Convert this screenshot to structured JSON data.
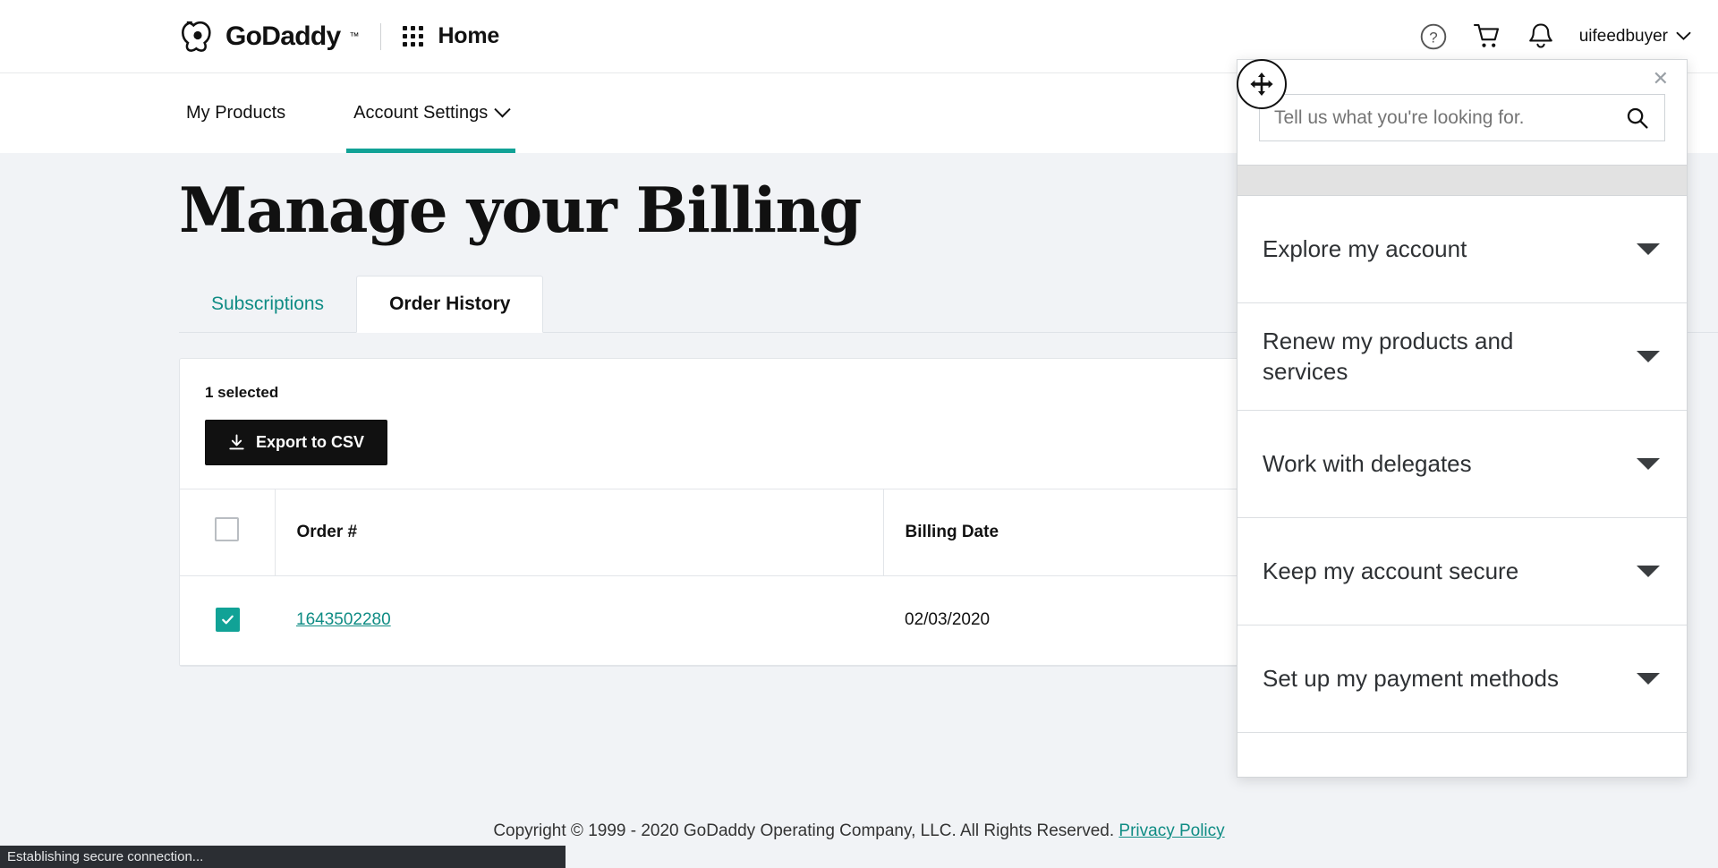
{
  "header": {
    "brand": "GoDaddy",
    "brand_tm": "™",
    "app_label": "Home",
    "help_icon": "question-circle-icon",
    "cart_icon": "shopping-cart-icon",
    "bell_icon": "notification-bell-icon",
    "username": "uifeedbuyer"
  },
  "nav": {
    "items": [
      {
        "label": "My Products",
        "active": false,
        "has_caret": false
      },
      {
        "label": "Account Settings",
        "active": true,
        "has_caret": true
      }
    ]
  },
  "main": {
    "page_title": "Manage your Billing",
    "tabs": [
      {
        "label": "Subscriptions",
        "active": false
      },
      {
        "label": "Order History",
        "active": true
      }
    ],
    "selected_count_label": "1 selected",
    "export_button_label": "Export to CSV",
    "export_icon": "download-icon",
    "table": {
      "columns": [
        "Order #",
        "Billing Date"
      ],
      "header_checkbox_checked": false,
      "rows": [
        {
          "checked": true,
          "order_number": "1643502280",
          "billing_date": "02/03/2020"
        }
      ]
    }
  },
  "help_panel": {
    "close_icon": "close-icon",
    "move_icon": "move-cursor-icon",
    "search": {
      "placeholder": "Tell us what you're looking for.",
      "value": "",
      "icon": "search-icon"
    },
    "accordion": [
      {
        "label": "Explore my account"
      },
      {
        "label": "Renew my products and services"
      },
      {
        "label": "Work with delegates"
      },
      {
        "label": "Keep my account secure"
      },
      {
        "label": "Set up my payment methods"
      }
    ]
  },
  "footer": {
    "copyright": "Copyright © 1999 - 2020 GoDaddy Operating Company, LLC. All Rights Reserved.",
    "privacy_link": "Privacy Policy"
  },
  "status_bar": {
    "message": "Establishing secure connection..."
  },
  "colors": {
    "accent_teal": "#11a296",
    "link_teal": "#0f8c84",
    "dark_button": "#111111",
    "page_bg": "#f1f3f6"
  }
}
